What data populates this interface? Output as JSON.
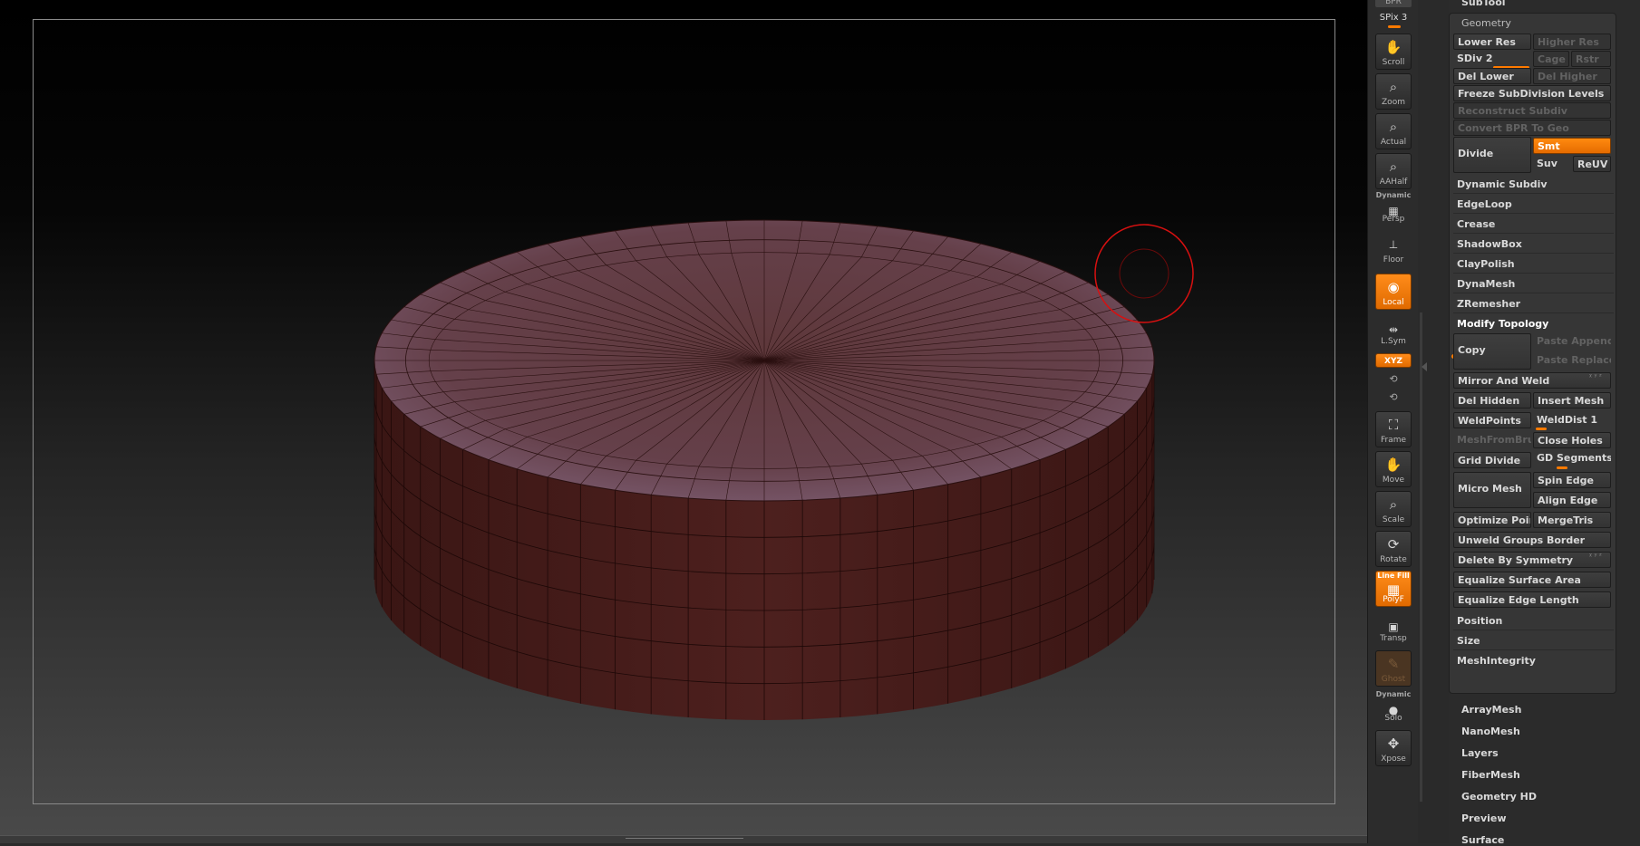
{
  "shelf": {
    "top_button": "BPR",
    "spix": "SPix 3",
    "buttons": [
      {
        "label": "Scroll",
        "icon": "hand-icon"
      },
      {
        "label": "Zoom",
        "icon": "magnifier-icon"
      },
      {
        "label": "Actual",
        "icon": "magnifier-icon"
      },
      {
        "label": "AAHalf",
        "icon": "magnifier-icon"
      },
      {
        "label": "Persp",
        "icon": "perspective-icon",
        "caption": "Dynamic"
      },
      {
        "label": "Floor",
        "icon": "floor-icon"
      },
      {
        "label": "Local",
        "icon": "local-icon"
      },
      {
        "label": "L.Sym",
        "icon": "symmetry-icon"
      },
      {
        "label": "Frame",
        "icon": "frame-icon"
      },
      {
        "label": "Move",
        "icon": "hand-icon"
      },
      {
        "label": "Scale",
        "icon": "magnifier-icon"
      },
      {
        "label": "Rotate",
        "icon": "rotate-icon"
      },
      {
        "label": "PolyF",
        "icon": "polyframe-icon",
        "caption": "Line Fill"
      },
      {
        "label": "Transp",
        "icon": "transparent-icon"
      },
      {
        "label": "Ghost",
        "icon": "ghost-icon"
      },
      {
        "label": "Solo",
        "icon": "solo-icon",
        "caption": "Dynamic"
      },
      {
        "label": "Xpose",
        "icon": "xpose-icon"
      }
    ],
    "xyz": "XYZ"
  },
  "tray": {
    "subtool_label": "SubTool",
    "geometry_title": "Geometry",
    "lower_res": "Lower Res",
    "higher_res": "Higher Res",
    "sdiv": "SDiv 2",
    "cage": "Cage",
    "rstr": "Rstr",
    "del_lower": "Del Lower",
    "del_higher": "Del Higher",
    "freeze": "Freeze SubDivision Levels",
    "reconstruct": "Reconstruct Subdiv",
    "convert_bpr": "Convert BPR To Geo",
    "divide": "Divide",
    "smt": "Smt",
    "suv": "Suv",
    "reuv": "ReUV",
    "sections": [
      "Dynamic Subdiv",
      "EdgeLoop",
      "Crease",
      "ShadowBox",
      "ClayPolish",
      "DynaMesh",
      "ZRemesher"
    ],
    "modify_topology": "Modify Topology",
    "copy": "Copy",
    "paste_append": "Paste Append",
    "paste_replace": "Paste Replace",
    "mirror_weld": "Mirror And Weld",
    "del_hidden": "Del Hidden",
    "insert_mesh": "Insert Mesh",
    "weldpoints": "WeldPoints",
    "welddist": "WeldDist 1",
    "meshfrombrush": "MeshFromBrush",
    "close_holes": "Close Holes",
    "grid_divide": "Grid Divide",
    "gd_segments": "GD Segments",
    "micro_mesh": "Micro Mesh",
    "spin_edge": "Spin Edge",
    "align_edge": "Align Edge",
    "optimize_points": "Optimize Points",
    "mergetris": "MergeTris",
    "unweld_groups": "Unweld Groups Border",
    "delete_by_symmetry": "Delete By Symmetry",
    "equalize_surface": "Equalize Surface Area",
    "equalize_edge": "Equalize Edge Length",
    "sub_sections": [
      "Position",
      "Size",
      "MeshIntegrity"
    ],
    "palettes": [
      "ArrayMesh",
      "NanoMesh",
      "Layers",
      "FiberMesh",
      "Geometry HD",
      "Preview",
      "Surface"
    ]
  },
  "colors": {
    "accent": "#ff7a00",
    "mesh_side": "#4a1e1c",
    "mesh_top": "#6a4446",
    "brush_cursor": "#e01010"
  }
}
